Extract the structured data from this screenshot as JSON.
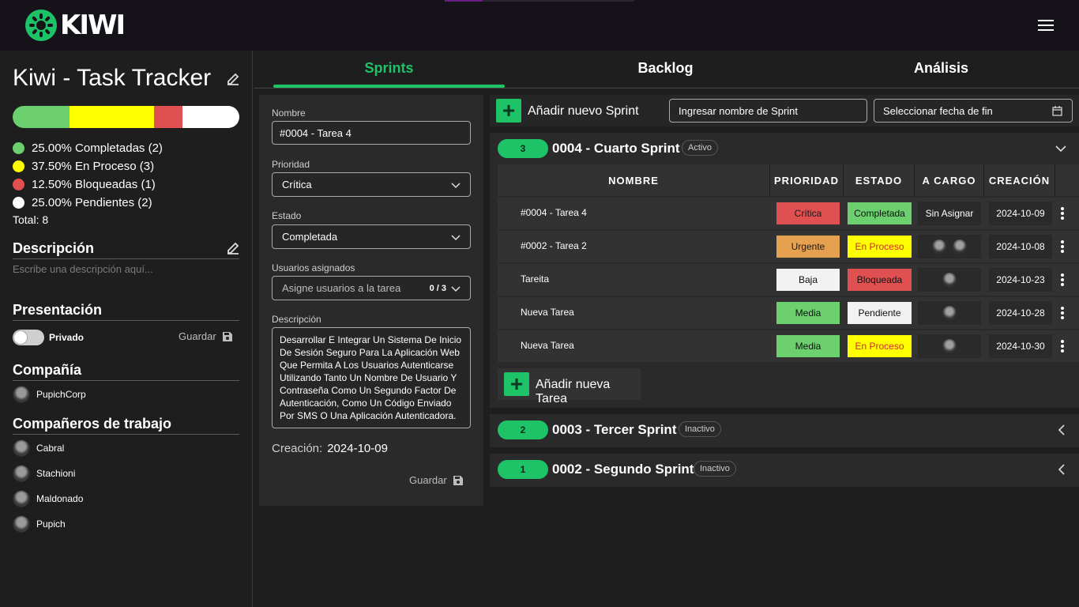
{
  "app": {
    "logo_text": "KIWI"
  },
  "tabs": [
    {
      "label": "Sprints",
      "active": true
    },
    {
      "label": "Backlog",
      "active": false
    },
    {
      "label": "Análisis",
      "active": false
    }
  ],
  "project": {
    "title": "Kiwi - Task Tracker",
    "progress": [
      {
        "key": "completed",
        "fraction": 0.25,
        "color": "#6bd06d"
      },
      {
        "key": "in_progress",
        "fraction": 0.375,
        "color": "#ffff00"
      },
      {
        "key": "blocked",
        "fraction": 0.125,
        "color": "#e05050"
      },
      {
        "key": "pending",
        "fraction": 0.25,
        "color": "#ffffff"
      }
    ],
    "legend": [
      {
        "text": "25.00% Completadas (2)",
        "color": "#6bd06d"
      },
      {
        "text": "37.50% En Proceso (3)",
        "color": "#ffff00"
      },
      {
        "text": "12.50% Bloqueadas (1)",
        "color": "#e05050"
      },
      {
        "text": "25.00% Pendientes (2)",
        "color": "#ffffff"
      }
    ],
    "total": "Total: 8",
    "description_title": "Descripción",
    "description_placeholder": "Escribe una descripción aquí...",
    "presentation_title": "Presentación",
    "privacy_label": "Privado",
    "save_label": "Guardar",
    "company_title": "Compañía",
    "company": "PupichCorp",
    "coworkers_title": "Compañeros de trabajo",
    "coworkers": [
      "Cabral",
      "Stachioni",
      "Maldonado",
      "Pupich"
    ]
  },
  "task_form": {
    "name_label": "Nombre",
    "name_value": "#0004 - Tarea 4",
    "priority_label": "Prioridad",
    "priority_value": "Crítica",
    "status_label": "Estado",
    "status_value": "Completada",
    "users_label": "Usuarios asignados",
    "users_placeholder": "Asigne usuarios a la tarea",
    "users_count": "0 / 3",
    "description_label": "Descripción",
    "description_value": "Desarrollar E Integrar Un Sistema De Inicio De Sesión Seguro Para La Aplicación Web Que Permita A Los Usuarios Autenticarse Utilizando Tanto Un Nombre De Usuario Y Contraseña Como Un Segundo Factor De Autenticación, Como Un Código Enviado Por SMS O Una Aplicación Autenticadora.",
    "creation_label": "Creación:",
    "creation_value": "2024-10-09",
    "save_label": "Guardar"
  },
  "sprint_bar": {
    "add_label": "Añadir nuevo Sprint",
    "name_placeholder": "Ingresar nombre de Sprint",
    "date_placeholder": "Seleccionar fecha de fin"
  },
  "table_headers": [
    "NOMBRE",
    "PRIORIDAD",
    "ESTADO",
    "A CARGO",
    "CREACIÓN"
  ],
  "sprints": [
    {
      "count": "3",
      "name": "0004 - Cuarto Sprint",
      "status": "Activo",
      "expanded": true,
      "add_task_label": "Añadir nueva Tarea",
      "tasks": [
        {
          "name": "#0004 - Tarea 4",
          "priority": "Crítica",
          "priority_color": "#e05050",
          "status": "Completada",
          "status_color": "#6bd06d",
          "assignee_text": "Sin Asignar",
          "avatars": 0,
          "created": "2024-10-09"
        },
        {
          "name": "#0002 - Tarea 2",
          "priority": "Urgente",
          "priority_color": "#e5a050",
          "status": "En Proceso",
          "status_color": "#ffff00",
          "assignee_text": "",
          "avatars": 2,
          "created": "2024-10-08"
        },
        {
          "name": "Tareita",
          "priority": "Baja",
          "priority_color": "#f2f2f2",
          "status": "Bloqueada",
          "status_color": "#e05050",
          "assignee_text": "",
          "avatars": 1,
          "created": "2024-10-23"
        },
        {
          "name": "Nueva Tarea",
          "priority": "Media",
          "priority_color": "#6bd06d",
          "status": "Pendiente",
          "status_color": "#f2f2f2",
          "assignee_text": "",
          "avatars": 1,
          "created": "2024-10-28"
        },
        {
          "name": "Nueva Tarea",
          "priority": "Media",
          "priority_color": "#6bd06d",
          "status": "En Proceso",
          "status_color": "#ffff00",
          "assignee_text": "",
          "avatars": 1,
          "created": "2024-10-30"
        }
      ]
    },
    {
      "count": "2",
      "name": "0003 - Tercer Sprint",
      "status": "Inactivo",
      "expanded": false
    },
    {
      "count": "1",
      "name": "0002 - Segundo Sprint",
      "status": "Inactivo",
      "expanded": false
    }
  ]
}
